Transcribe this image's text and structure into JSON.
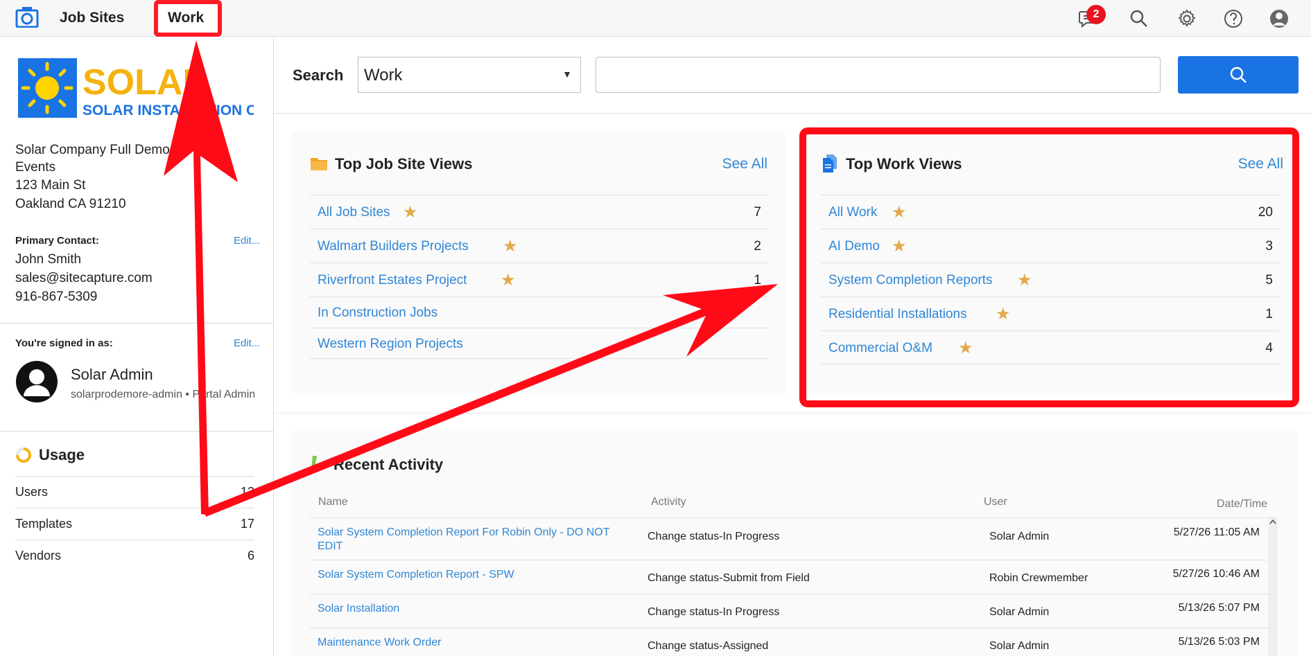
{
  "topbar": {
    "nav_job_sites": "Job Sites",
    "nav_work": "Work",
    "notification_count": "2"
  },
  "sidebar": {
    "company_logo_text": "SOLAR",
    "company_logo_subtext": "SOLAR INSTALLATION CO.",
    "company_name": "Solar Company Full Demo for Trade Events",
    "address_line1": "123 Main St",
    "address_line2": "Oakland CA 91210",
    "primary_contact_label": "Primary Contact:",
    "edit_label": "Edit...",
    "contact_name": "John Smith",
    "contact_email": "sales@sitecapture.com",
    "contact_phone": "916-867-5309",
    "signed_in_label": "You're signed in as:",
    "user_name": "Solar Admin",
    "user_detail": "solarprodemore-admin • Portal Admin",
    "usage_title": "Usage",
    "usage": [
      {
        "label": "Users",
        "value": "13"
      },
      {
        "label": "Templates",
        "value": "17"
      },
      {
        "label": "Vendors",
        "value": "6"
      }
    ]
  },
  "search": {
    "label": "Search",
    "selected": "Work",
    "placeholder": ""
  },
  "job_site_views": {
    "title": "Top Job Site Views",
    "see_all": "See All",
    "rows": [
      {
        "name": "All Job Sites",
        "count": "7",
        "starred": true
      },
      {
        "name": "Walmart Builders Projects",
        "count": "2",
        "starred": true
      },
      {
        "name": "Riverfront Estates Project",
        "count": "1",
        "starred": true
      },
      {
        "name": "In Construction Jobs",
        "count": "",
        "starred": false
      },
      {
        "name": "Western Region Projects",
        "count": "",
        "starred": false
      }
    ]
  },
  "work_views": {
    "title": "Top Work Views",
    "see_all": "See All",
    "rows": [
      {
        "name": "All Work",
        "count": "20",
        "starred": true
      },
      {
        "name": "AI Demo",
        "count": "3",
        "starred": true
      },
      {
        "name": "System Completion Reports",
        "count": "5",
        "starred": true
      },
      {
        "name": "Residential Installations",
        "count": "1",
        "starred": true
      },
      {
        "name": "Commercial O&M",
        "count": "4",
        "starred": true
      }
    ]
  },
  "recent_activity": {
    "title": "Recent Activity",
    "columns": [
      "Name",
      "Activity",
      "User",
      "Date/Time"
    ],
    "rows": [
      {
        "name": "Solar System Completion Report For Robin Only - DO NOT EDIT",
        "activity": "Change status-In Progress",
        "user": "Solar Admin",
        "datetime": "5/27/26 11:05 AM"
      },
      {
        "name": "Solar System Completion Report - SPW",
        "activity": "Change status-Submit from Field",
        "user": "Robin Crewmember",
        "datetime": "5/27/26 10:46 AM"
      },
      {
        "name": "Solar Installation",
        "activity": "Change status-In Progress",
        "user": "Solar Admin",
        "datetime": "5/13/26 5:07 PM"
      },
      {
        "name": "Maintenance Work Order",
        "activity": "Change status-Assigned",
        "user": "Solar Admin",
        "datetime": "5/13/26 5:03 PM"
      }
    ]
  },
  "colors": {
    "accent": "#2f86d6",
    "primary_button": "#1a73e3",
    "annotation_red": "#ff0a17",
    "star": "#e3a94a"
  }
}
